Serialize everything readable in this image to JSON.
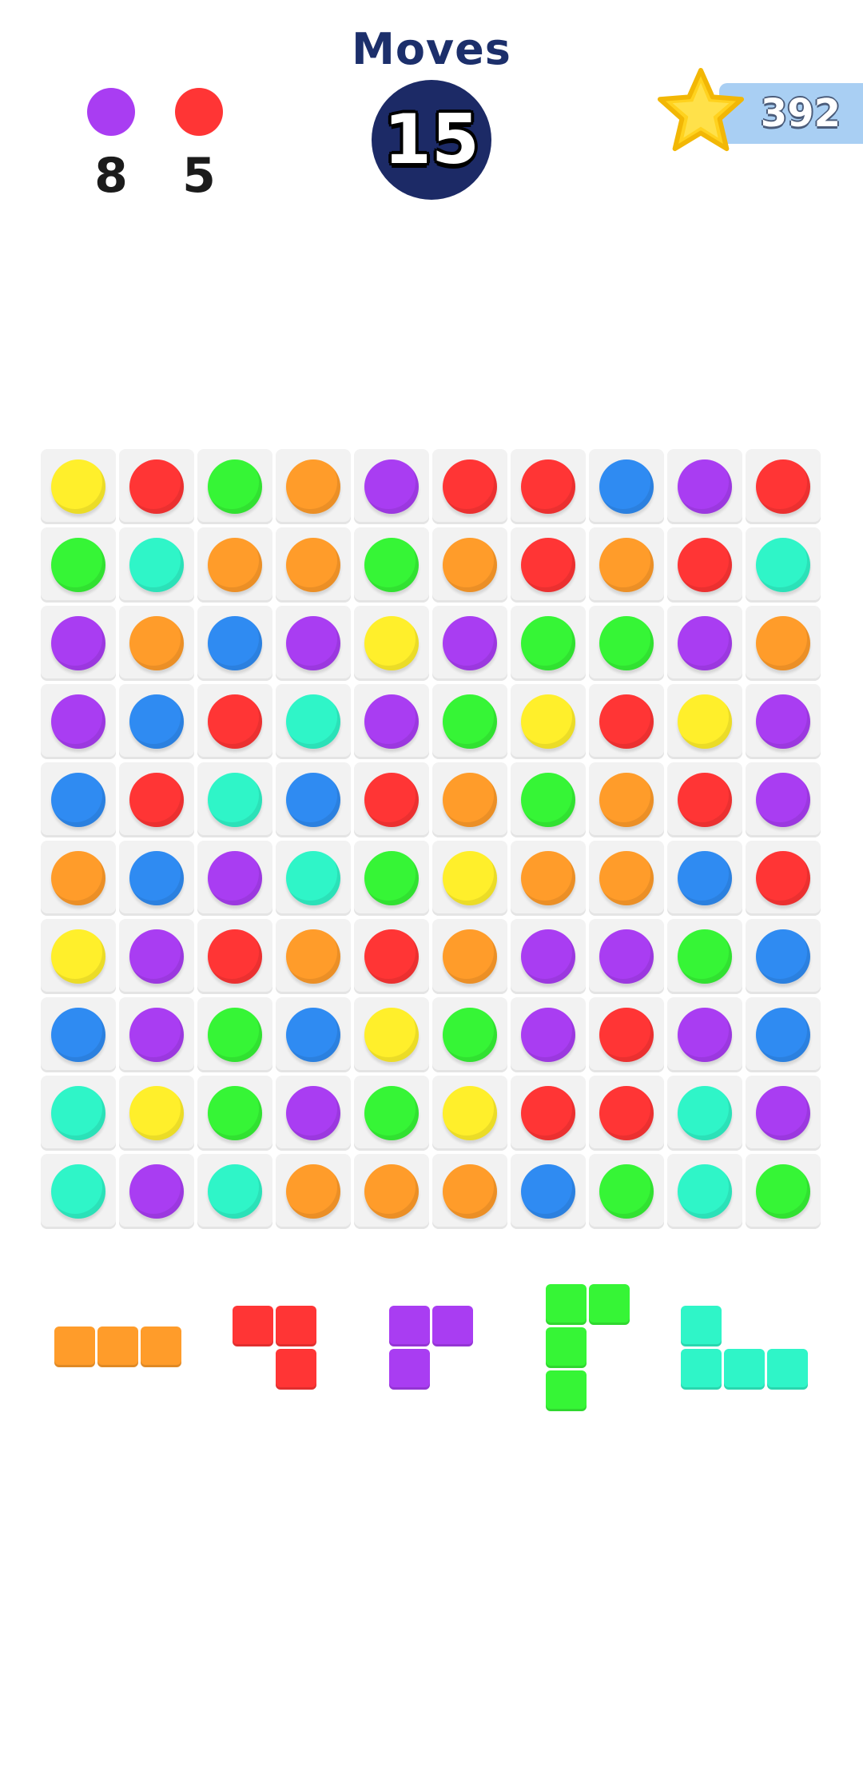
{
  "colors": {
    "yellow": "#ffef2b",
    "red": "#ff3535",
    "green": "#36f536",
    "orange": "#ff9c2a",
    "purple": "#a93df2",
    "blue": "#2f8bf2",
    "teal": "#2ff5c8",
    "navy": "#1c2a66",
    "score_bar": "#a9cff3",
    "star": "#ffd21e"
  },
  "header": {
    "goals": [
      {
        "color": "purple",
        "count": "8"
      },
      {
        "color": "red",
        "count": "5"
      }
    ],
    "moves_label": "Moves",
    "moves_value": "15",
    "score_value": "392",
    "star_icon": "star-icon"
  },
  "board": {
    "rows": 10,
    "cols": 10,
    "cells": [
      [
        "yellow",
        "red",
        "green",
        "orange",
        "purple",
        "red",
        "red",
        "blue",
        "purple",
        "red"
      ],
      [
        "green",
        "teal",
        "orange",
        "orange",
        "green",
        "orange",
        "red",
        "orange",
        "red",
        "teal"
      ],
      [
        "purple",
        "orange",
        "blue",
        "purple",
        "yellow",
        "purple",
        "green",
        "green",
        "purple",
        "orange"
      ],
      [
        "purple",
        "blue",
        "red",
        "teal",
        "purple",
        "green",
        "yellow",
        "red",
        "yellow",
        "purple"
      ],
      [
        "blue",
        "red",
        "teal",
        "blue",
        "red",
        "orange",
        "green",
        "orange",
        "red",
        "purple"
      ],
      [
        "orange",
        "blue",
        "purple",
        "teal",
        "green",
        "yellow",
        "orange",
        "orange",
        "blue",
        "red"
      ],
      [
        "yellow",
        "purple",
        "red",
        "orange",
        "red",
        "orange",
        "purple",
        "purple",
        "green",
        "blue"
      ],
      [
        "blue",
        "purple",
        "green",
        "blue",
        "yellow",
        "green",
        "purple",
        "red",
        "purple",
        "blue"
      ],
      [
        "teal",
        "yellow",
        "green",
        "purple",
        "green",
        "yellow",
        "red",
        "red",
        "teal",
        "purple"
      ],
      [
        "teal",
        "purple",
        "teal",
        "orange",
        "orange",
        "orange",
        "blue",
        "green",
        "teal",
        "green"
      ]
    ]
  },
  "pieces": [
    {
      "color": "orange",
      "shape": [
        [
          1,
          1,
          1
        ]
      ]
    },
    {
      "color": "red",
      "shape": [
        [
          1,
          1
        ],
        [
          0,
          1
        ]
      ]
    },
    {
      "color": "purple",
      "shape": [
        [
          1,
          1
        ],
        [
          1,
          0
        ]
      ]
    },
    {
      "color": "green",
      "shape": [
        [
          1,
          1
        ],
        [
          1,
          0
        ],
        [
          1,
          0
        ]
      ]
    },
    {
      "color": "teal",
      "shape": [
        [
          1,
          0,
          0
        ],
        [
          1,
          1,
          1
        ]
      ]
    }
  ]
}
